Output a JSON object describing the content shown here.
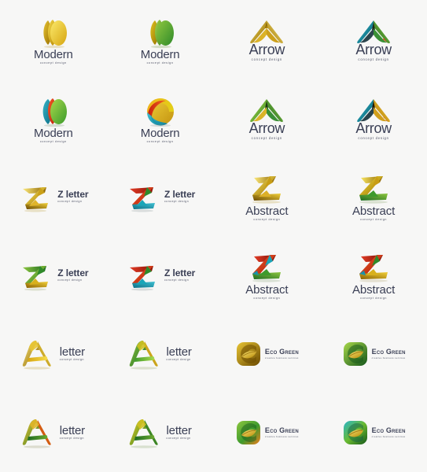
{
  "page": {
    "background_color": "#f7f7f6",
    "grid_columns": 4,
    "grid_rows": 6,
    "description": "Abstract geometric logo template collection sheet"
  },
  "common": {
    "tagline": "concept design",
    "eco_tagline": "creative business services"
  },
  "palette": {
    "gold_light": "#f2d03a",
    "gold": "#d4a017",
    "gold_dark": "#8a6100",
    "green_light": "#8cc63f",
    "green": "#3ea03a",
    "green_dark": "#1d6b22",
    "red": "#e23b26",
    "red_dark": "#a8200f",
    "orange": "#f07c1c",
    "teal": "#1aa5b8",
    "teal_dark": "#0d6f86",
    "blue": "#2b8fc4",
    "text_dark": "#3a3f55"
  },
  "logos": [
    {
      "id": "modern-gold",
      "mark": "sphere-leaves-icon",
      "title": "Modern",
      "subtitle": "concept design",
      "layout": "vertical",
      "colors": [
        "#f2d03a",
        "#d4a017",
        "#8a6100"
      ]
    },
    {
      "id": "modern-green-gold",
      "mark": "sphere-leaves-icon",
      "title": "Modern",
      "subtitle": "concept design",
      "layout": "vertical",
      "colors": [
        "#d4b516",
        "#8cc63f",
        "#3ea03a"
      ]
    },
    {
      "id": "arrow-gold",
      "mark": "arrow-peak-icon",
      "title": "Arrow",
      "subtitle": "concept design",
      "layout": "vertical",
      "colors": [
        "#f2d03a",
        "#c79a10",
        "#6b4a00"
      ]
    },
    {
      "id": "arrow-teal-green",
      "mark": "arrow-peak-icon",
      "title": "Arrow",
      "subtitle": "concept design",
      "layout": "vertical",
      "colors": [
        "#1aa5b8",
        "#3ea03a",
        "#1d6b22"
      ]
    },
    {
      "id": "modern-multicolor",
      "mark": "sphere-leaves-icon",
      "title": "Modern",
      "subtitle": "concept design",
      "layout": "vertical",
      "colors": [
        "#1aa5b8",
        "#e23b26",
        "#8cc63f"
      ]
    },
    {
      "id": "modern-sunset",
      "mark": "sphere-swirl-icon",
      "title": "Modern",
      "subtitle": "concept design",
      "layout": "vertical",
      "colors": [
        "#e2b416",
        "#e23b26",
        "#1aa5b8"
      ]
    },
    {
      "id": "arrow-green",
      "mark": "arrow-peak-icon",
      "title": "Arrow",
      "subtitle": "concept design",
      "layout": "vertical",
      "colors": [
        "#8cc63f",
        "#3ea03a",
        "#d4a017"
      ]
    },
    {
      "id": "arrow-teal-gold",
      "mark": "arrow-peak-icon",
      "title": "Arrow",
      "subtitle": "concept design",
      "layout": "vertical",
      "colors": [
        "#1aa5b8",
        "#e2a31a",
        "#e23b26"
      ]
    },
    {
      "id": "z-letter-gold",
      "mark": "z-letter-icon",
      "title": "Z letter",
      "subtitle": "concept design",
      "layout": "horizontal",
      "colors": [
        "#f2d03a",
        "#d4a017",
        "#8a6100"
      ]
    },
    {
      "id": "z-letter-red-teal",
      "mark": "z-letter-icon",
      "title": "Z letter",
      "subtitle": "concept design",
      "layout": "horizontal",
      "colors": [
        "#e23b26",
        "#1aa5b8",
        "#3ea03a"
      ]
    },
    {
      "id": "abstract-gold",
      "mark": "abstract-z-icon",
      "title": "Abstract",
      "subtitle": "concept design",
      "layout": "vertical",
      "colors": [
        "#f2d03a",
        "#c79a10",
        "#6b4a00"
      ]
    },
    {
      "id": "abstract-gold-green",
      "mark": "abstract-z-icon",
      "title": "Abstract",
      "subtitle": "concept design",
      "layout": "vertical",
      "colors": [
        "#e2c016",
        "#8cc63f",
        "#3ea03a"
      ]
    },
    {
      "id": "z-letter-green",
      "mark": "z-letter-icon",
      "title": "Z letter",
      "subtitle": "concept design",
      "layout": "horizontal",
      "colors": [
        "#8cc63f",
        "#3ea03a",
        "#d4a017"
      ]
    },
    {
      "id": "z-letter-red-teal-2",
      "mark": "z-letter-icon",
      "title": "Z letter",
      "subtitle": "concept design",
      "layout": "horizontal",
      "colors": [
        "#e23b26",
        "#1aa5b8",
        "#3ea03a"
      ]
    },
    {
      "id": "abstract-red-green",
      "mark": "abstract-z-icon",
      "title": "Abstract",
      "subtitle": "concept design",
      "layout": "vertical",
      "colors": [
        "#e23b26",
        "#1aa5b8",
        "#3ea03a"
      ]
    },
    {
      "id": "abstract-red-gold",
      "mark": "abstract-z-icon",
      "title": "Abstract",
      "subtitle": "concept design",
      "layout": "vertical",
      "colors": [
        "#e23b26",
        "#3ea03a",
        "#d4a017"
      ]
    },
    {
      "id": "a-letter-gold",
      "mark": "a-letter-icon",
      "title": "letter",
      "subtitle": "concept design",
      "layout": "horizontal",
      "colors": [
        "#f2d03a",
        "#d4a017",
        "#8a6100"
      ]
    },
    {
      "id": "a-letter-green-gold",
      "mark": "a-letter-icon",
      "title": "letter",
      "subtitle": "concept design",
      "layout": "horizontal",
      "colors": [
        "#3ea03a",
        "#8cc63f",
        "#d4a017"
      ]
    },
    {
      "id": "eco-green-gold",
      "mark": "eco-leaf-square-icon",
      "title": "Eco Green",
      "subtitle": "creative business services",
      "layout": "horizontal",
      "colors": [
        "#d4a017",
        "#8a6100",
        "#f2d03a"
      ]
    },
    {
      "id": "eco-green-green",
      "mark": "eco-leaf-square-icon",
      "title": "Eco Green",
      "subtitle": "creative business services",
      "layout": "horizontal",
      "colors": [
        "#3ea03a",
        "#8cc63f",
        "#d4a017"
      ]
    },
    {
      "id": "a-letter-orange-green",
      "mark": "a-letter-icon",
      "title": "letter",
      "subtitle": "concept design",
      "layout": "horizontal",
      "colors": [
        "#f07c1c",
        "#8cc63f",
        "#1d6b22"
      ]
    },
    {
      "id": "a-letter-yellow-green",
      "mark": "a-letter-icon",
      "title": "letter",
      "subtitle": "concept design",
      "layout": "horizontal",
      "colors": [
        "#d4c016",
        "#3ea03a",
        "#1d6b22"
      ]
    },
    {
      "id": "eco-green-orange",
      "mark": "eco-leaf-square-icon",
      "title": "Eco Green",
      "subtitle": "creative business services",
      "layout": "horizontal",
      "colors": [
        "#f07c1c",
        "#8cc63f",
        "#3ea03a"
      ]
    },
    {
      "id": "eco-green-teal",
      "mark": "eco-leaf-square-icon",
      "title": "Eco Green",
      "subtitle": "creative business services",
      "layout": "horizontal",
      "colors": [
        "#1aa5b8",
        "#8cc63f",
        "#3ea03a"
      ]
    }
  ]
}
